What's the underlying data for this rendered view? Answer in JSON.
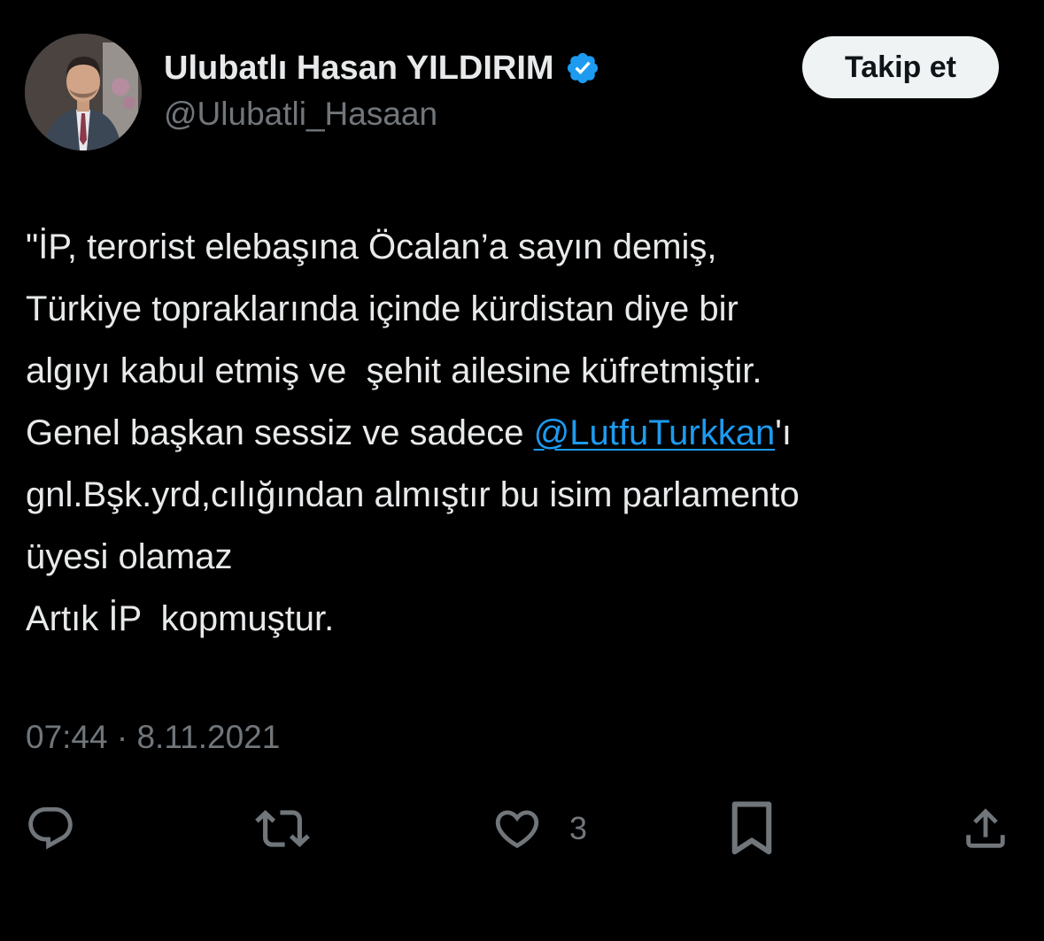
{
  "author": {
    "display_name": "Ulubatlı Hasan YILDIRIM",
    "handle": "@Ulubatli_Hasaan",
    "verified": true,
    "verified_color": "#1d9bf0"
  },
  "follow_button": {
    "label": "Takip et"
  },
  "tweet": {
    "lines": [
      {
        "text": "\"İP, terorist elebaşına Öcalan’a sayın demiş,"
      },
      {
        "text": "Türkiye topraklarında içinde kürdistan diye bir"
      },
      {
        "text": "algıyı kabul etmiş ve  şehit ailesine küfretmiştir."
      },
      {
        "before": "Genel başkan sessiz ve sadece ",
        "mention": "@LutfuTurkkan",
        "after": "'ı"
      },
      {
        "text": "gnl.Bşk.yrd,cılığından almıştır bu isim parlamento"
      },
      {
        "text": "üyesi olamaz"
      },
      {
        "text": "Artık İP  kopmuştur."
      }
    ],
    "time": "07:44",
    "separator": "·",
    "date": "8.11.2021"
  },
  "actions": {
    "like_count": "3",
    "icons": [
      "reply-icon",
      "retweet-icon",
      "like-icon",
      "bookmark-icon",
      "share-icon"
    ],
    "icon_color": "#71767b"
  },
  "colors": {
    "background": "#000000",
    "text_primary": "#e7e9ea",
    "text_secondary": "#71767b",
    "link": "#1d9bf0",
    "button_bg": "#eff3f4",
    "button_text": "#0f1419"
  }
}
